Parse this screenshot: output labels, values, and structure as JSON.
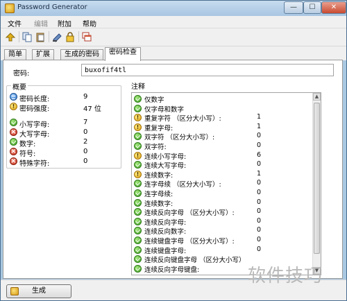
{
  "window": {
    "title": "Password Generator",
    "controls": {
      "minimize": "—",
      "maximize": "☐",
      "close": "✕"
    }
  },
  "menu": [
    {
      "label": "文件",
      "disabled": false
    },
    {
      "label": "编辑",
      "disabled": true
    },
    {
      "label": "附加",
      "disabled": false
    },
    {
      "label": "帮助",
      "disabled": false
    }
  ],
  "toolbar": {
    "icons": [
      "generate-icon",
      "copy-icon",
      "paste-icon",
      "clear-icon",
      "lock-icon",
      "key-icon",
      "windows-icon"
    ]
  },
  "tabs": [
    {
      "label": "简单",
      "active": false
    },
    {
      "label": "扩展",
      "active": false
    },
    {
      "label": "生成的密码",
      "active": false
    },
    {
      "label": "密码检查",
      "active": true
    }
  ],
  "password": {
    "label": "密码:",
    "value": "buxofif4tl"
  },
  "summary": {
    "title": "概要",
    "rows": [
      {
        "icon": "info",
        "label": "密码长度:",
        "value": "9"
      },
      {
        "icon": "warn",
        "label": "密码强度:",
        "value": "47 位"
      },
      {
        "icon": "ok",
        "label": "小写字母:",
        "value": "7"
      },
      {
        "icon": "err",
        "label": "大写字母:",
        "value": "0"
      },
      {
        "icon": "ok",
        "label": "数字:",
        "value": "2"
      },
      {
        "icon": "err",
        "label": "符号:",
        "value": "0"
      },
      {
        "icon": "err",
        "label": "特殊字符:",
        "value": "0"
      }
    ]
  },
  "notes": {
    "title": "注释",
    "rows": [
      {
        "icon": "ok",
        "label": "仅数字",
        "value": ""
      },
      {
        "icon": "ok",
        "label": "仅字母和数字",
        "value": ""
      },
      {
        "icon": "warn",
        "label": "重复字符 （区分大小写）:",
        "value": "1"
      },
      {
        "icon": "warn",
        "label": "重复字母:",
        "value": "1"
      },
      {
        "icon": "ok",
        "label": "双字符 （区分大小写）:",
        "value": "0"
      },
      {
        "icon": "ok",
        "label": "双字符:",
        "value": "0"
      },
      {
        "icon": "warn",
        "label": "连续小写字母:",
        "value": "6"
      },
      {
        "icon": "ok",
        "label": "连续大写字母:",
        "value": "0"
      },
      {
        "icon": "warn",
        "label": "连续数字:",
        "value": "1"
      },
      {
        "icon": "ok",
        "label": "连字母续 （区分大小写）:",
        "value": "0"
      },
      {
        "icon": "ok",
        "label": "连字母续:",
        "value": "0"
      },
      {
        "icon": "ok",
        "label": "连续数字:",
        "value": "0"
      },
      {
        "icon": "ok",
        "label": "连续反向字母 （区分大小写）:",
        "value": "0"
      },
      {
        "icon": "ok",
        "label": "连续反向字母:",
        "value": "0"
      },
      {
        "icon": "ok",
        "label": "连续反向数字:",
        "value": "0"
      },
      {
        "icon": "ok",
        "label": "连续键盘字母 （区分大小写）:",
        "value": "0"
      },
      {
        "icon": "ok",
        "label": "连续键盘字母:",
        "value": "0"
      },
      {
        "icon": "ok",
        "label": "连续反向键盘字母 （区分大小写）",
        "value": ""
      },
      {
        "icon": "ok",
        "label": "连续反向字母键盘:",
        "value": ""
      }
    ]
  },
  "footer": {
    "generate_label": "生成"
  },
  "watermark": "软件技巧"
}
